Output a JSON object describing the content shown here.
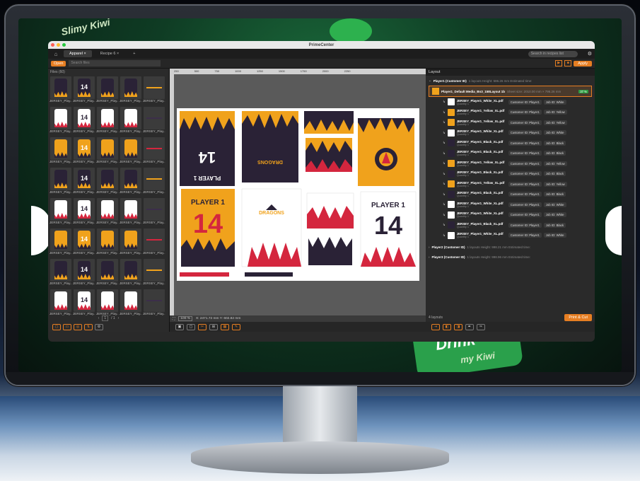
{
  "window": {
    "title": "PrimeCenter"
  },
  "background": {
    "brand_text_top": "Slimy Kiwi",
    "brand_text_bottom": "Drink",
    "brand_sub_bottom": "my Kiwi"
  },
  "tabs": [
    {
      "label": "Apparel",
      "close": "×"
    },
    {
      "label": "Recipe 6",
      "close": "×"
    },
    {
      "label": "+"
    }
  ],
  "recipe_search": {
    "placeholder": "Search in recipes list"
  },
  "toolbar": {
    "open_label": "Open",
    "search_placeholder": "Search files",
    "apply_label": "Apply",
    "play_icon": "▶",
    "stop_icon": "■"
  },
  "files": {
    "header": "Files (60)",
    "label": "JERSEY_Play...",
    "pagination": {
      "current": "1",
      "total": "/ 1",
      "prev": "‹",
      "next": "›"
    }
  },
  "canvas": {
    "ruler": [
      "250",
      "500",
      "750",
      "1000",
      "1250",
      "1500",
      "1750",
      "2000",
      "2250"
    ],
    "zoom": "100 %",
    "coords": "X: 2471.72 mm   Y: 602.82 mm",
    "jersey_texts": {
      "player": "PLAYER 1",
      "number": "14",
      "team": "DRAGONS"
    }
  },
  "layout": {
    "header": "Layout",
    "groups": [
      {
        "name": "Player1 (Customer ID)",
        "meta": "1 layouts  Height: 586.26 mm  Estimated time:"
      },
      {
        "name": "Player2 (Customer ID)",
        "meta": "1 layouts  Height: 998.21 mm  Estimated time:"
      },
      {
        "name": "Player3 (Customer ID)",
        "meta": "1 layouts  Height: 998.96 mm  Estimated time:"
      }
    ],
    "main_job": {
      "name": "Player1_Default Media_Bn3_158Layout 1b",
      "meta": "Sheet size: 2010.00 mm × 796.26 mm",
      "badge": "37 %"
    },
    "items": [
      {
        "name": "JERSEY_Player1_White_XL.pdf",
        "cid": "Customer ID: Player1",
        "job": "Job ID: White",
        "color": "#ffffff"
      },
      {
        "name": "JERSEY_Player1_Yellow_XL.pdf",
        "cid": "Customer ID: Player1",
        "job": "Job ID: Yellow",
        "color": "#f0a21c"
      },
      {
        "name": "JERSEY_Player1_Yellow_XL.pdf",
        "cid": "Customer ID: Player1",
        "job": "Job ID: Yellow",
        "color": "#f0a21c"
      },
      {
        "name": "JERSEY_Player1_White_XL.pdf",
        "cid": "Customer ID: Player1",
        "job": "Job ID: White",
        "color": "#ffffff"
      },
      {
        "name": "JERSEY_Player1_Black_XL.pdf",
        "cid": "Customer ID: Player1",
        "job": "Job ID: Black",
        "color": "#2a2236"
      },
      {
        "name": "JERSEY_Player1_Black_XL.pdf",
        "cid": "Customer ID: Player1",
        "job": "Job ID: Black",
        "color": "#2a2236"
      },
      {
        "name": "JERSEY_Player1_Yellow_XL.pdf",
        "cid": "Customer ID: Player1",
        "job": "Job ID: Yellow",
        "color": "#f0a21c"
      },
      {
        "name": "JERSEY_Player1_Black_XL.pdf",
        "cid": "Customer ID: Player1",
        "job": "Job ID: Black",
        "color": "#2a2236"
      },
      {
        "name": "JERSEY_Player1_Yellow_XL.pdf",
        "cid": "Customer ID: Player1",
        "job": "Job ID: Yellow",
        "color": "#f0a21c"
      },
      {
        "name": "JERSEY_Player1_Black_XL.pdf",
        "cid": "Customer ID: Player1",
        "job": "Job ID: Black",
        "color": "#2a2236"
      },
      {
        "name": "JERSEY_Player1_White_XL.pdf",
        "cid": "Customer ID: Player1",
        "job": "Job ID: White",
        "color": "#ffffff"
      },
      {
        "name": "JERSEY_Player1_White_XL.pdf",
        "cid": "Customer ID: Player1",
        "job": "Job ID: White",
        "color": "#ffffff"
      },
      {
        "name": "JERSEY_Player1_Black_XL.pdf",
        "cid": "Customer ID: Player1",
        "job": "Job ID: Black",
        "color": "#2a2236"
      },
      {
        "name": "JERSEY_Player1_White_XL.pdf",
        "cid": "Customer ID: Player1",
        "job": "Job ID: White",
        "color": "#ffffff"
      }
    ],
    "quantity": "Quantity 1",
    "footer_count": "4 layouts",
    "print_label": "Print & Cut"
  },
  "colors": {
    "accent": "#e67e22",
    "navy": "#2a2236",
    "yellow": "#f0a21c",
    "red": "#d4263e"
  }
}
